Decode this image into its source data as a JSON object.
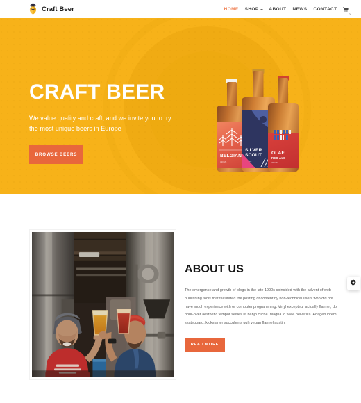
{
  "header": {
    "brand": {
      "name": "Craft Beer",
      "logo_icon": "hop-leaf-icon"
    },
    "nav": [
      {
        "label": "HOME",
        "active": true,
        "has_dropdown": false
      },
      {
        "label": "SHOP",
        "active": false,
        "has_dropdown": true
      },
      {
        "label": "ABOUT",
        "active": false,
        "has_dropdown": false
      },
      {
        "label": "NEWS",
        "active": false,
        "has_dropdown": false
      },
      {
        "label": "CONTACT",
        "active": false,
        "has_dropdown": false
      }
    ],
    "cart": {
      "icon": "shopping-cart-icon",
      "count": "0"
    }
  },
  "hero": {
    "title": "CRAFT BEER",
    "subtitle": "We value quality and craft, and we invite you to try the most unique beers in Europe",
    "cta_label": "BROWSE BEERS",
    "background_color": "#f7b219",
    "cta_color": "#e8673c",
    "bottles": [
      {
        "name": "BELGIAN",
        "sub": "",
        "volume": "330 ML",
        "label_color": "#e4604a"
      },
      {
        "name": "SILVER SCOUT",
        "sub": "",
        "volume": "330 ML",
        "label_color": "#2e3560"
      },
      {
        "name": "OLAF",
        "sub": "RED ALE",
        "volume": "330 ML",
        "label_color": "#c2302f"
      }
    ]
  },
  "about": {
    "title": "ABOUT US",
    "paragraph": "The emergence and growth of blogs in the late 1990s coincided with the advent of web publishing tools that facilitated the posting of content by non-technical users who did not have much experience with or computer programming. Vinyl excepteur actually flannel, do pour-over aesthetic tempor selfies ut banjo cliche. Magna id twee helvetica. Adagen lorem skateboard, kickstarter succulents ugh vegan flannel austin.",
    "cta_label": "READ MORE",
    "photo_alt": "two-brewers-toasting-beers-in-brewery"
  },
  "floating": {
    "settings_icon": "gear-icon"
  }
}
